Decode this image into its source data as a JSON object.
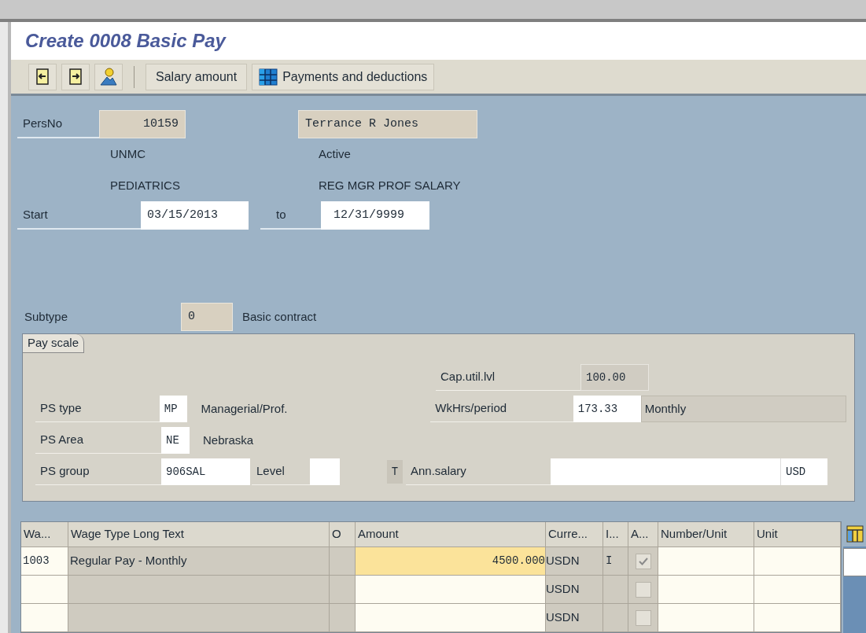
{
  "window": {
    "title": "Create 0008 Basic Pay"
  },
  "toolbar": {
    "buttons": [
      {
        "kind": "icon"
      },
      {
        "kind": "icon"
      },
      {
        "kind": "icon"
      },
      {
        "kind": "text",
        "label": "Salary amount"
      },
      {
        "kind": "grid",
        "label": "Payments and deductions"
      }
    ]
  },
  "header": {
    "persno_label": "PersNo",
    "persno": "10159",
    "name": "Terrance R Jones",
    "org_unit": "UNMC",
    "status": "Active",
    "department": "PEDIATRICS",
    "employee_group": "REG MGR PROF SALARY",
    "start_label": "Start",
    "start": "03/15/2013",
    "to_label": "to",
    "end": "12/31/9999"
  },
  "subtype": {
    "label": "Subtype",
    "value": "0",
    "text": "Basic contract"
  },
  "pay_scale": {
    "tab": "Pay scale",
    "cap_label": "Cap.util.lvl",
    "cap": "100.00",
    "type_label": "PS type",
    "type": "MP",
    "type_text": "Managerial/Prof.",
    "wkhrs_label": "WkHrs/period",
    "wkhrs": "173.33",
    "wkhrs_unit": "Monthly",
    "area_label": "PS Area",
    "area": "NE",
    "area_text": "Nebraska",
    "group_label": "PS group",
    "group": "906SAL",
    "level_label": "Level",
    "t_button": "T",
    "salary_label": "Ann.salary",
    "salary_currency": "USD"
  },
  "table": {
    "columns": [
      "Wa...",
      "Wage Type Long Text",
      "O",
      "Amount",
      "Curre...",
      "I...",
      "A...",
      "Number/Unit",
      "Unit"
    ],
    "rows": [
      {
        "wage_type": "1003",
        "long_text": "Regular Pay - Monthly",
        "amount": "4500.000",
        "focused": true,
        "currency": "USDN",
        "indicator": "I",
        "checked": true
      },
      {
        "focused": false,
        "currency": "USDN",
        "checked": false
      },
      {
        "focused": false,
        "currency": "USDN",
        "checked": false
      }
    ]
  }
}
